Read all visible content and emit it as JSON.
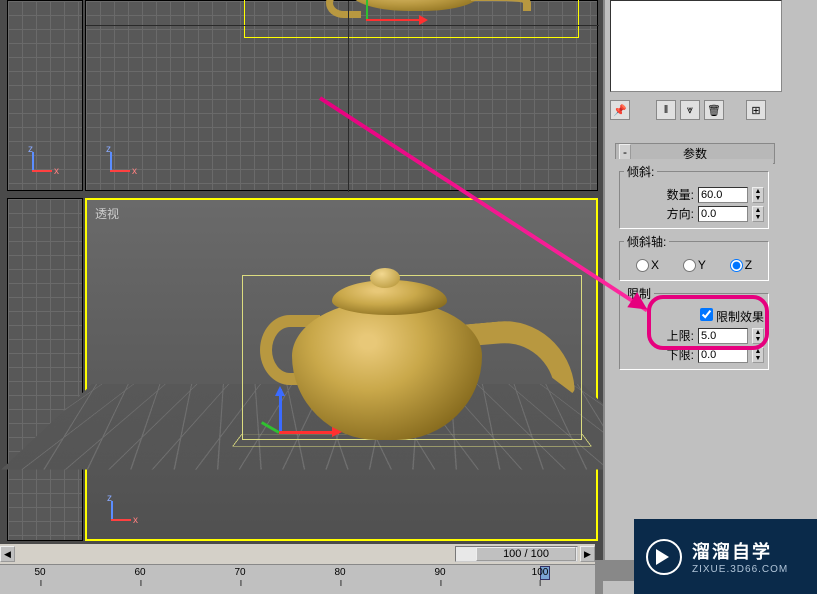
{
  "viewport": {
    "perspective_label": "透视"
  },
  "axis": {
    "z": "z",
    "x": "x"
  },
  "panel": {
    "title": "参数",
    "tilt": {
      "legend": "倾斜:",
      "amount_label": "数量:",
      "amount_value": "60.0",
      "direction_label": "方向:",
      "direction_value": "0.0"
    },
    "tilt_axis": {
      "legend": "倾斜轴:",
      "x": "X",
      "y": "Y",
      "z": "Z",
      "selected": "Z"
    },
    "limit": {
      "legend": "限制",
      "effect_label": "限制效果",
      "effect_checked": true,
      "upper_label": "上限:",
      "upper_value": "5.0",
      "lower_label": "下限:",
      "lower_value": "0.0"
    }
  },
  "timeline": {
    "frame_display": "100 / 100",
    "ticks": [
      50,
      60,
      70,
      80,
      90,
      100
    ]
  },
  "watermark": {
    "title": "溜溜自学",
    "url": "ZIXUE.3D66.COM"
  }
}
